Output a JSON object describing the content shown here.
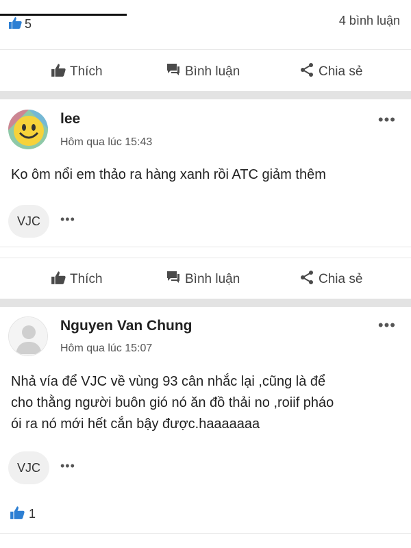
{
  "top": {
    "like_count": "5",
    "comment_count": "4 bình luận"
  },
  "actions": {
    "like": "Thích",
    "comment": "Bình luận",
    "share": "Chia sẻ"
  },
  "posts": [
    {
      "author": "lee",
      "time": "Hôm qua lúc 15:43",
      "content": "Ko ôm nổi em thảo ra hàng xanh rồi ATC giảm thêm",
      "tag": "VJC",
      "more": "•••"
    },
    {
      "author": "Nguyen Van Chung",
      "time": "Hôm qua lúc 15:07",
      "content_lines": [
        "Nhả vía để VJC về vùng 93 cân nhắc lại ,cũng là để",
        "cho thằng người buôn gió nó ăn đồ thải no ,roiif pháo",
        "ói ra nó mới hết cắn bậy được.haaaaaaa"
      ],
      "tag": "VJC",
      "more": "•••",
      "like_count": "1"
    }
  ],
  "colors": {
    "like_blue": "#2d7fd3",
    "icon_gray": "#4a4a4a",
    "divider": "#e3e3e3"
  }
}
